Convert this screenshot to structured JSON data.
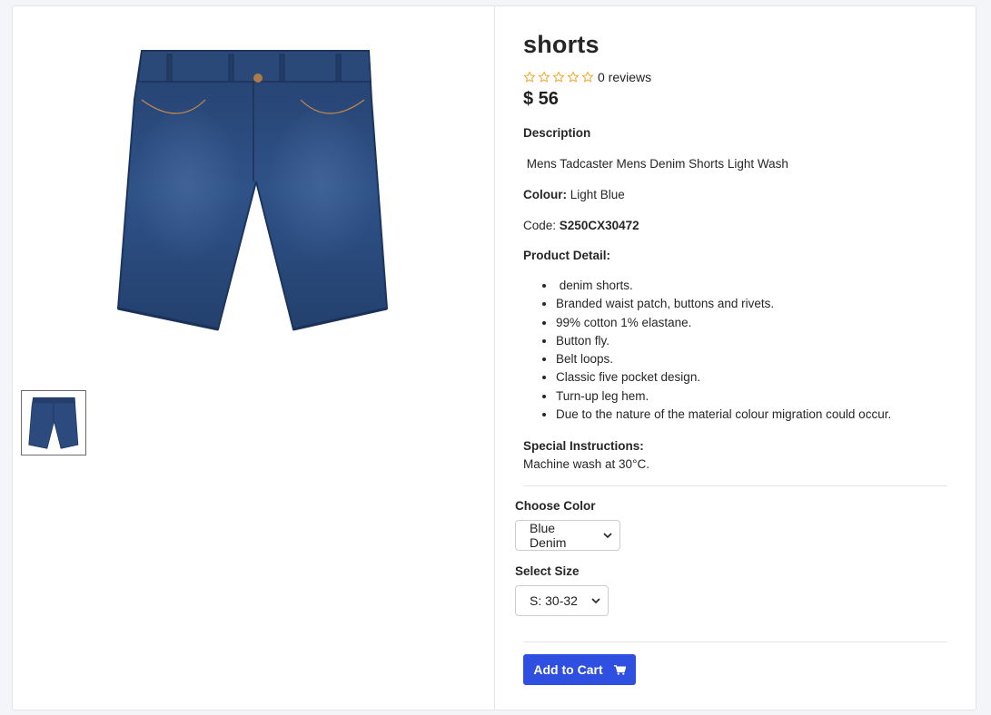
{
  "product": {
    "title": "shorts",
    "rating_stars": 0,
    "reviews_label": "0 reviews",
    "price": "$ 56",
    "description_heading": "Description",
    "description": " Mens Tadcaster Mens Denim Shorts Light Wash",
    "colour_label": "Colour:",
    "colour_value": "Light Blue",
    "code_label": "Code:",
    "code_value": "S250CX30472",
    "detail_heading": "Product Detail:",
    "details": [
      " denim shorts.",
      "Branded waist patch, buttons and rivets.",
      "99% cotton 1% elastane.",
      "Button fly.",
      "Belt loops.",
      "Classic five pocket design.",
      "Turn-up leg hem.",
      "Due to the nature of the material colour migration could occur."
    ],
    "special_heading": "Special Instructions:",
    "special_text": "Machine wash at 30°C."
  },
  "options": {
    "color_label": "Choose Color",
    "color_selected": "Blue Denim",
    "size_label": "Select Size",
    "size_selected": "S: 30-32"
  },
  "actions": {
    "add_to_cart": "Add to Cart"
  },
  "colors": {
    "accent": "#2f4fe0",
    "star": "#f0a92e",
    "denim": "#2a4a7f"
  },
  "icons": {
    "star": "star-outline-icon",
    "cart": "cart-icon",
    "dropdown": "chevron-down-icon"
  }
}
